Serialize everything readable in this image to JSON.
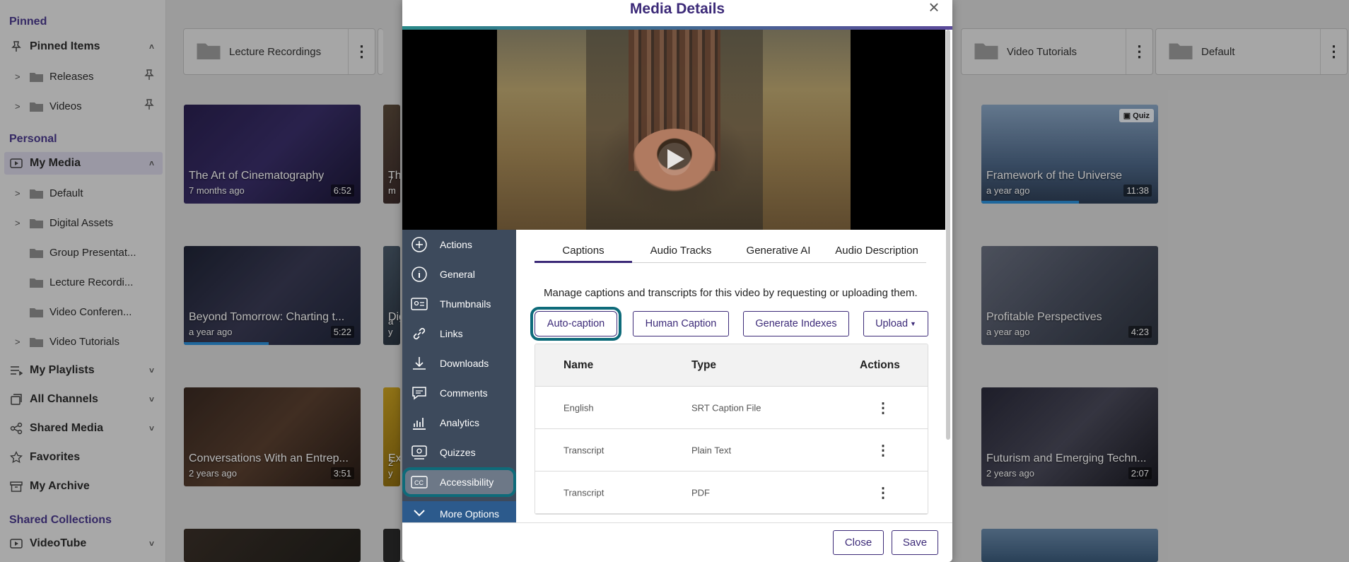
{
  "sidebar": {
    "pinned_title": "Pinned",
    "pinned_items_label": "Pinned Items",
    "pinned": [
      "Releases",
      "Videos"
    ],
    "personal_title": "Personal",
    "my_media_label": "My Media",
    "my_media_children": [
      "Default",
      "Digital Assets",
      "Group Presentat...",
      "Lecture Recordi...",
      "Video Conferen...",
      "Video Tutorials"
    ],
    "my_playlists": "My Playlists",
    "all_channels": "All Channels",
    "shared_media": "Shared Media",
    "favorites": "Favorites",
    "my_archive": "My Archive",
    "shared_collections_title": "Shared Collections",
    "videotube": "VideoTube"
  },
  "folders": [
    "Lecture Recordings",
    "Video Tutorials",
    "Default"
  ],
  "videos": [
    {
      "title": "The Art of Cinematography",
      "age": "7 months ago",
      "duration": "6:52"
    },
    {
      "title": "Th",
      "age": "7 m"
    },
    {
      "title": "Framework of the Universe",
      "age": "a year ago",
      "duration": "11:38",
      "badge": "Quiz",
      "progress": 0.55
    },
    {
      "title": "Beyond Tomorrow: Charting t...",
      "age": "a year ago",
      "duration": "5:22",
      "progress": 0.48
    },
    {
      "title": "Dig",
      "age": "a y"
    },
    {
      "title": "Profitable Perspectives",
      "age": "a year ago",
      "duration": "4:23"
    },
    {
      "title": "Conversations With an Entrep...",
      "age": "2 years ago",
      "duration": "3:51"
    },
    {
      "title": "Ex",
      "age": "2 y"
    },
    {
      "title": "Futurism and Emerging Techn...",
      "age": "2 years ago",
      "duration": "2:07"
    }
  ],
  "modal": {
    "title": "Media Details",
    "close_icon": "×",
    "nav": [
      "Actions",
      "General",
      "Thumbnails",
      "Links",
      "Downloads",
      "Comments",
      "Analytics",
      "Quizzes",
      "Accessibility"
    ],
    "more_options": "More Options",
    "tabs": [
      "Captions",
      "Audio Tracks",
      "Generative AI",
      "Audio Description"
    ],
    "description": "Manage captions and transcripts for this video by requesting or uploading them.",
    "buttons": {
      "auto_caption": "Auto-caption",
      "human_caption": "Human Caption",
      "generate_indexes": "Generate Indexes",
      "upload": "Upload"
    },
    "table": {
      "headers": [
        "Name",
        "Type",
        "Actions"
      ],
      "rows": [
        {
          "name": "English",
          "type": "SRT Caption File"
        },
        {
          "name": "Transcript",
          "type": "Plain Text"
        },
        {
          "name": "Transcript",
          "type": "PDF"
        }
      ]
    },
    "footer": {
      "close": "Close",
      "save": "Save"
    }
  },
  "colors": {
    "accent": "#3c2a78",
    "focus": "#0e6b7a",
    "nav_bg": "#3d4a5c"
  }
}
